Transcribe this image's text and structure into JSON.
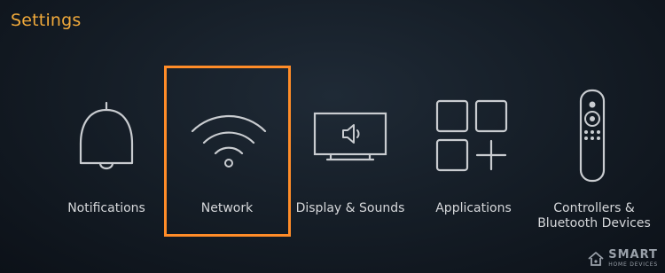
{
  "header": {
    "title": "Settings"
  },
  "menu": {
    "items": [
      {
        "label": "Notifications",
        "icon": "bell-icon",
        "selected": false
      },
      {
        "label": "Network",
        "icon": "wifi-icon",
        "selected": true
      },
      {
        "label": "Display & Sounds",
        "icon": "tv-speaker-icon",
        "selected": false
      },
      {
        "label": "Applications",
        "icon": "apps-grid-icon",
        "selected": false
      },
      {
        "label": "Controllers &\nBluetooth Devices",
        "label_line1": "Controllers &",
        "label_line2": "Bluetooth Devices",
        "icon": "remote-icon",
        "selected": false
      }
    ]
  },
  "watermark": {
    "line1": "SMART",
    "line2": "HOME DEVICES"
  },
  "colors": {
    "accent": "#f0a93a",
    "focus": "#ff8c28",
    "text": "#d5d7da",
    "icon": "#c9ccd0",
    "background": "#141c25"
  }
}
